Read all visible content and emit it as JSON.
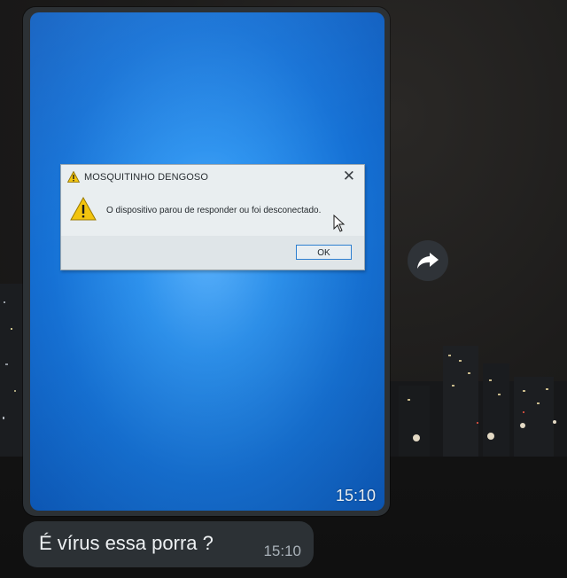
{
  "dialog": {
    "title": "MOSQUITINHO DENGOSO",
    "close_glyph": "✕",
    "message": "O dispositivo parou de responder ou foi desconectado.",
    "ok_label": "OK"
  },
  "media_message": {
    "time": "15:10"
  },
  "text_message": {
    "text": "É vírus essa porra ?",
    "time": "15:10"
  },
  "icons": {
    "warning": "warning-icon",
    "cursor": "mouse-cursor-icon",
    "forward": "forward-arrow-icon"
  },
  "colors": {
    "screen_blue": "#1c7fe0",
    "bubble": "#2c3135",
    "dialog_bg": "#e9eef0",
    "ok_border": "#2d7fd0",
    "warning_yellow": "#f2c40f"
  }
}
